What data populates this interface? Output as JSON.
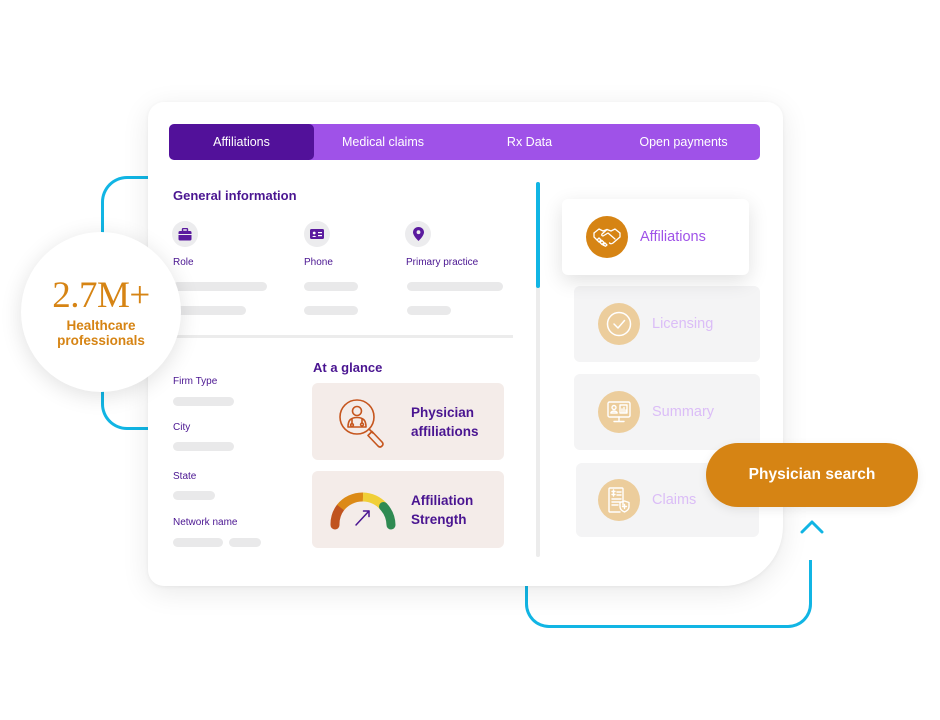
{
  "tabs": [
    {
      "label": "Affiliations",
      "active": true
    },
    {
      "label": "Medical claims",
      "active": false
    },
    {
      "label": "Rx Data",
      "active": false
    },
    {
      "label": "Open payments",
      "active": false
    }
  ],
  "general_information": {
    "title": "General information",
    "fields": [
      {
        "label": "Role",
        "icon": "briefcase-icon"
      },
      {
        "label": "Phone",
        "icon": "id-card-icon"
      },
      {
        "label": "Primary practice",
        "icon": "location-pin-icon"
      }
    ]
  },
  "details": {
    "fields": [
      {
        "label": "Firm Type"
      },
      {
        "label": "City"
      },
      {
        "label": "State"
      },
      {
        "label": "Network name"
      }
    ]
  },
  "at_a_glance": {
    "title": "At a glance",
    "cards": [
      {
        "line1": "Physician",
        "line2": "affiliations",
        "icon": "physician-search-icon"
      },
      {
        "line1": "Affiliation",
        "line2": "Strength",
        "icon": "gauge-icon"
      }
    ]
  },
  "sidebar": {
    "items": [
      {
        "label": "Affiliations",
        "icon": "handshake-icon",
        "active": true
      },
      {
        "label": "Licensing",
        "icon": "check-circle-icon",
        "active": false
      },
      {
        "label": "Summary",
        "icon": "monitor-report-icon",
        "active": false
      },
      {
        "label": "Claims",
        "icon": "claim-document-icon",
        "active": false
      }
    ]
  },
  "stat": {
    "value": "2.7M+",
    "label_line1": "Healthcare",
    "label_line2": "professionals"
  },
  "cta": {
    "label": "Physician search"
  },
  "colors": {
    "primary_purple": "#9f52e8",
    "dark_purple": "#52119a",
    "text_purple": "#4a1591",
    "accent_orange": "#d68414",
    "connector_blue": "#11b5e4"
  }
}
